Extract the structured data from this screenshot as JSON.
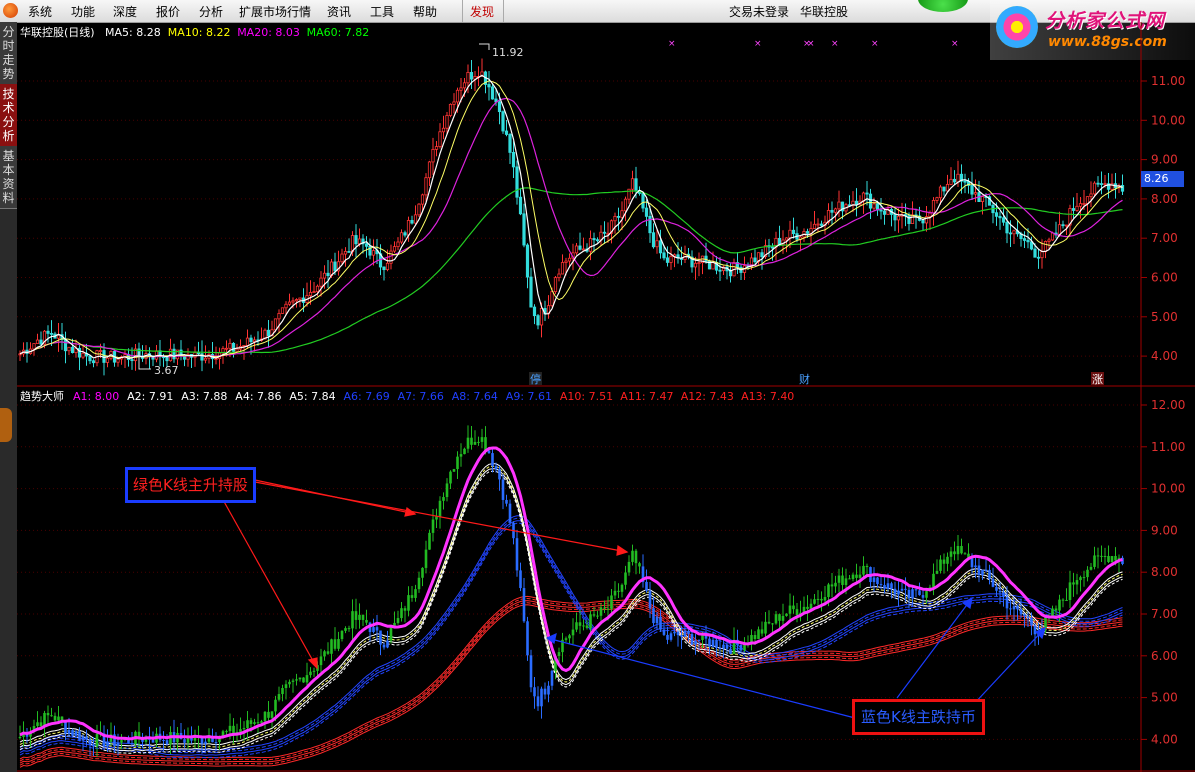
{
  "menu": {
    "items": [
      "系统",
      "功能",
      "深度",
      "报价",
      "分析",
      "扩展市场行情",
      "资讯",
      "工具",
      "帮助"
    ],
    "discover": "发现",
    "login_status": "交易未登录",
    "stock_name": "华联控股"
  },
  "watermark": {
    "title": "分析家公式网",
    "url": "www.88gs.com"
  },
  "left_tabs": [
    {
      "label": "分时走势",
      "active": false
    },
    {
      "label": "技术分析",
      "active": true
    },
    {
      "label": "基本资料",
      "active": false
    }
  ],
  "main_panel": {
    "title": "华联控股(日线)",
    "ma": [
      {
        "label": "MA5:",
        "value": "8.28",
        "color": "#ffffff"
      },
      {
        "label": "MA10:",
        "value": "8.22",
        "color": "#ffff00"
      },
      {
        "label": "MA20:",
        "value": "8.03",
        "color": "#ff00ff"
      },
      {
        "label": "MA60:",
        "value": "7.82",
        "color": "#00ff00"
      }
    ],
    "y_ticks": [
      "11.00",
      "10.00",
      "9.00",
      "8.00",
      "7.00",
      "6.00",
      "5.00",
      "4.00"
    ],
    "high_label": "11.92",
    "low_label": "3.67",
    "current_price": "8.26",
    "event_marks": [
      "停",
      "财",
      "涨"
    ]
  },
  "sub_panel": {
    "title": "趋势大师",
    "indicators": [
      {
        "label": "A1:",
        "value": "8.00",
        "color": "#ff00ff"
      },
      {
        "label": "A2:",
        "value": "7.91",
        "color": "#ffffff"
      },
      {
        "label": "A3:",
        "value": "7.88",
        "color": "#ffffff"
      },
      {
        "label": "A4:",
        "value": "7.86",
        "color": "#ffffff"
      },
      {
        "label": "A5:",
        "value": "7.84",
        "color": "#ffffff"
      },
      {
        "label": "A6:",
        "value": "7.69",
        "color": "#2040ff"
      },
      {
        "label": "A7:",
        "value": "7.66",
        "color": "#2040ff"
      },
      {
        "label": "A8:",
        "value": "7.64",
        "color": "#2040ff"
      },
      {
        "label": "A9:",
        "value": "7.61",
        "color": "#2040ff"
      },
      {
        "label": "A10:",
        "value": "7.51",
        "color": "#ff2020"
      },
      {
        "label": "A11:",
        "value": "7.47",
        "color": "#ff2020"
      },
      {
        "label": "A12:",
        "value": "7.43",
        "color": "#ff2020"
      },
      {
        "label": "A13:",
        "value": "7.40",
        "color": "#ff2020"
      }
    ],
    "y_ticks": [
      "12.00",
      "11.00",
      "10.00",
      "9.00",
      "8.00",
      "7.00",
      "6.00",
      "5.00",
      "4.00"
    ]
  },
  "annotations": {
    "green": "绿色K线主升持股",
    "blue": "蓝色K线主跌持币"
  }
}
